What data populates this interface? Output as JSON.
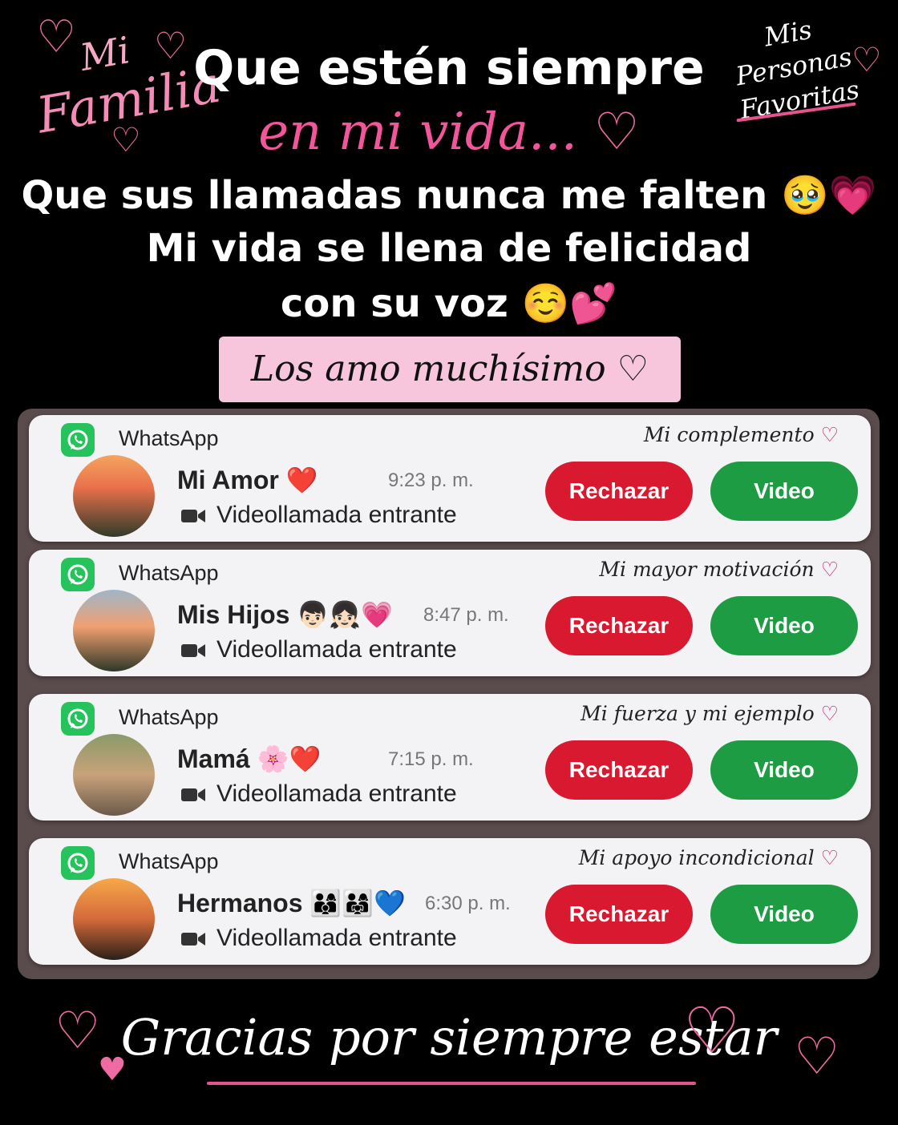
{
  "header": {
    "mi": "Mi",
    "familia": "Familia",
    "personas_line1": "Mis Personas",
    "personas_line2": "Favoritas",
    "title_line1": "Que estén siempre",
    "title_line2": "en mi vida...",
    "line1": "Que sus llamadas nunca me falten",
    "line1_emoji": "🥹💗",
    "line2": "Mi vida se llena de felicidad",
    "line3": "con su voz",
    "line3_emoji": "☺️💕",
    "badge": "Los amo muchísimo"
  },
  "cards": [
    {
      "app": "WhatsApp",
      "tagline": "Mi complemento",
      "contact": "Mi Amor",
      "emoji": "❤️",
      "time": "9:23 p. m.",
      "status": "Videollamada entrante",
      "reject": "Rechazar",
      "video": "Video"
    },
    {
      "app": "WhatsApp",
      "tagline": "Mi mayor motivación",
      "contact": "Mis Hijos",
      "emoji": "👦🏻👧🏻💗",
      "time": "8:47 p. m.",
      "status": "Videollamada entrante",
      "reject": "Rechazar",
      "video": "Video"
    },
    {
      "app": "WhatsApp",
      "tagline": "Mi fuerza y mi ejemplo",
      "contact": "Mamá",
      "emoji": "🌸❤️",
      "time": "7:15 p. m.",
      "status": "Videollamada entrante",
      "reject": "Rechazar",
      "video": "Video"
    },
    {
      "app": "WhatsApp",
      "tagline": "Mi apoyo incondicional",
      "contact": "Hermanos",
      "emoji": "👨‍👩‍👦👨‍👩‍👧💙",
      "time": "6:30 p. m.",
      "status": "Videollamada entrante",
      "reject": "Rechazar",
      "video": "Video"
    }
  ],
  "footer": "Gracias por siempre estar",
  "colors": {
    "pink": "#f2559a",
    "reject": "#d8192f",
    "video": "#1e9c43",
    "whatsapp": "#26c25b"
  }
}
